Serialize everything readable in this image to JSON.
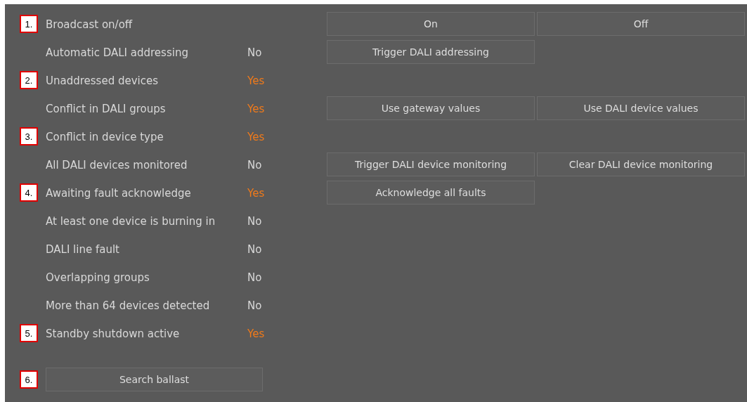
{
  "status_rows": [
    {
      "marker": "1.",
      "label": "Broadcast on/off",
      "buttons": [
        "On",
        "Off"
      ]
    },
    {
      "label": "Automatic DALI addressing",
      "value": "No",
      "alert": false,
      "buttons": [
        "Trigger DALI addressing"
      ]
    },
    {
      "marker": "2.",
      "label": "Unaddressed devices",
      "value": "Yes",
      "alert": true
    },
    {
      "label": "Conflict in DALI groups",
      "value": "Yes",
      "alert": true,
      "buttons": [
        "Use gateway values",
        "Use DALI device values"
      ]
    },
    {
      "marker": "3.",
      "label": "Conflict in device type",
      "value": "Yes",
      "alert": true
    },
    {
      "label": "All DALI devices monitored",
      "value": "No",
      "alert": false,
      "buttons": [
        "Trigger DALI device monitoring",
        "Clear DALI device monitoring"
      ]
    },
    {
      "marker": "4.",
      "label": "Awaiting fault acknowledge",
      "value": "Yes",
      "alert": true,
      "buttons": [
        "Acknowledge all faults"
      ]
    },
    {
      "label": "At least one device is burning in",
      "value": "No",
      "alert": false
    },
    {
      "label": "DALI line fault",
      "value": "No",
      "alert": false
    },
    {
      "label": "Overlapping groups",
      "value": "No",
      "alert": false
    },
    {
      "label": "More than 64 devices detected",
      "value": "No",
      "alert": false
    },
    {
      "marker": "5.",
      "label": "Standby shutdown active",
      "value": "Yes",
      "alert": true
    }
  ],
  "search": {
    "marker": "6.",
    "button": "Search ballast"
  }
}
